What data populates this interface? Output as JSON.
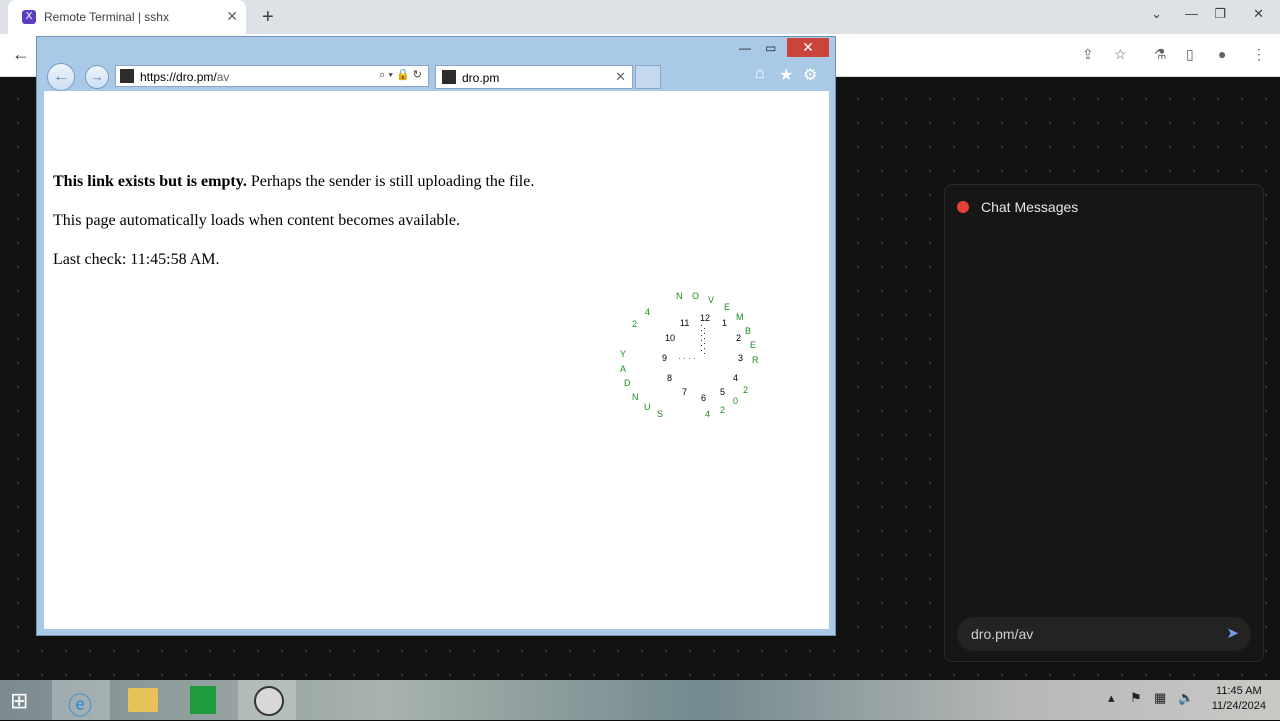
{
  "chrome": {
    "tab_title": "Remote Terminal | sshx",
    "tab_icon": "sshx-favicon-icon",
    "new_tab": "+",
    "close": "✕"
  },
  "ie": {
    "url_base": "https://dro.pm/",
    "url_path": "av",
    "tab_title": "dro.pm",
    "content": {
      "bold": "This link exists but is empty.",
      "rest": " Perhaps the sender is still uploading the file.",
      "line2": "This page automatically loads when content becomes available.",
      "line3": "Last check: 11:45:58 AM."
    },
    "clock": {
      "numbers": [
        "12",
        "1",
        "2",
        "3",
        "4",
        "5",
        "6",
        "7",
        "8",
        "9",
        "10",
        "11"
      ],
      "month": "NOVEMBER",
      "year": "2024",
      "day": "SUNDAY",
      "date": "24",
      "color": "#1b8a1b"
    }
  },
  "chat": {
    "title": "Chat Messages",
    "input_value": "dro.pm/av",
    "status_color": "#e5413a"
  },
  "taskbar": {
    "time": "11:45 AM",
    "date": "11/24/2024"
  }
}
